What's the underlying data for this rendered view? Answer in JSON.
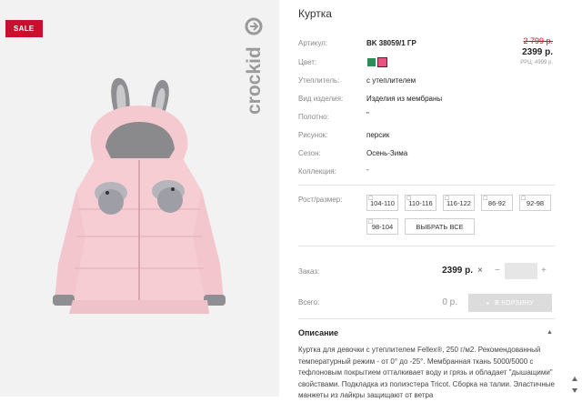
{
  "badge": "SALE",
  "brand": "crockid",
  "product": {
    "title": "Куртка",
    "labels": {
      "article": "Артикул:",
      "color": "Цвет:",
      "insulation": "Утеплитель:",
      "type": "Вид изделия:",
      "fabric": "Полотно:",
      "pattern": "Рисунок:",
      "season": "Сезон:",
      "collection": "Коллекция:",
      "sizes": "Рост/размер:"
    },
    "values": {
      "article": "BK 38059/1 ГР",
      "insulation": "с утеплителем",
      "type": "Изделия из мембраны",
      "fabric": "\"",
      "pattern": "персик",
      "season": "Осень-Зима",
      "collection": "-"
    },
    "colors": [
      "#2e8b57",
      "#e75480"
    ],
    "price": {
      "old": "2 799 р.",
      "new": "2399 р.",
      "rrc": "РРЦ: 4999 р."
    },
    "sizes": [
      "104-110",
      "110-116",
      "116-122",
      "86-92",
      "92-98",
      "98-104"
    ],
    "select_all": "ВЫБРАТЬ ВСЕ"
  },
  "order": {
    "label": "Заказ:",
    "price": "2399 р.",
    "times": "×",
    "minus": "−",
    "plus": "+",
    "total_label": "Всего:",
    "total": "0 р.",
    "cart_button": "В КОРЗИНУ"
  },
  "description": {
    "title": "Описание",
    "text": "Куртка для девочки с утеплителем Fellex®, 250 г/м2. Рекомендованный температурный режим - от 0° до -25°. Мембранная ткань 5000/5000 с тефлоновым покрытием отталкивает воду и грязь и обладает \"дышащими\" свойствами. Подкладка из полиэстера Tricot. Сборка на талии. Эластичные манжеты из лайкры защищают от ветра"
  }
}
